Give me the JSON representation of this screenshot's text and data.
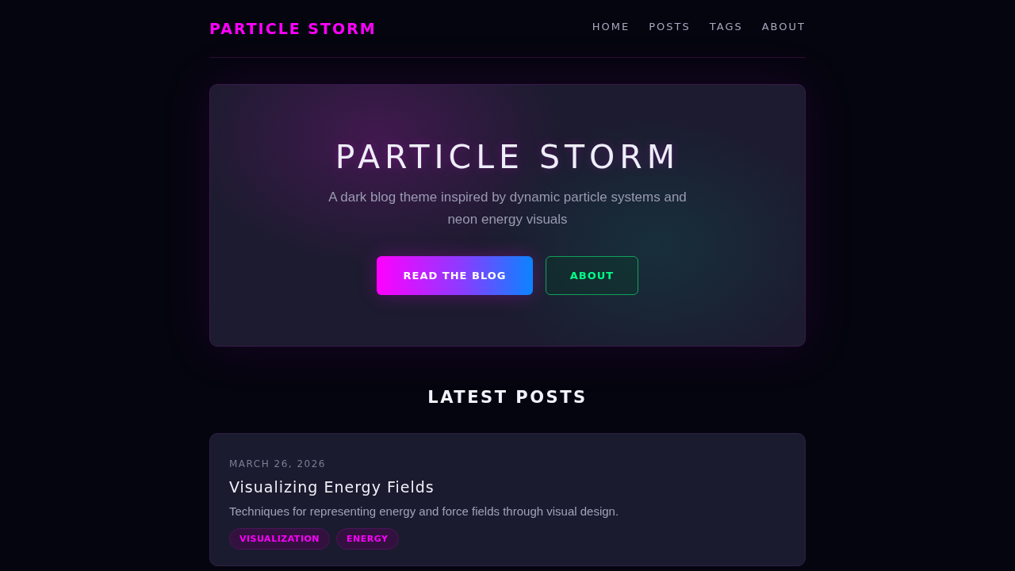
{
  "header": {
    "logo": "PARTICLE STORM",
    "nav": [
      "HOME",
      "POSTS",
      "TAGS",
      "ABOUT"
    ]
  },
  "hero": {
    "title": "PARTICLE STORM",
    "subtitle": "A dark blog theme inspired by dynamic particle systems and neon energy visuals",
    "buttons": [
      {
        "label": "READ THE BLOG",
        "kind": "primary"
      },
      {
        "label": "ABOUT",
        "kind": "outline"
      }
    ]
  },
  "latest_posts": {
    "heading": "LATEST POSTS",
    "posts": [
      {
        "date": "MARCH 26, 2026",
        "title": "Visualizing Energy Fields",
        "excerpt": "Techniques for representing energy and force fields through visual design.",
        "tags": [
          "VISUALIZATION",
          "ENERGY"
        ]
      }
    ]
  }
}
